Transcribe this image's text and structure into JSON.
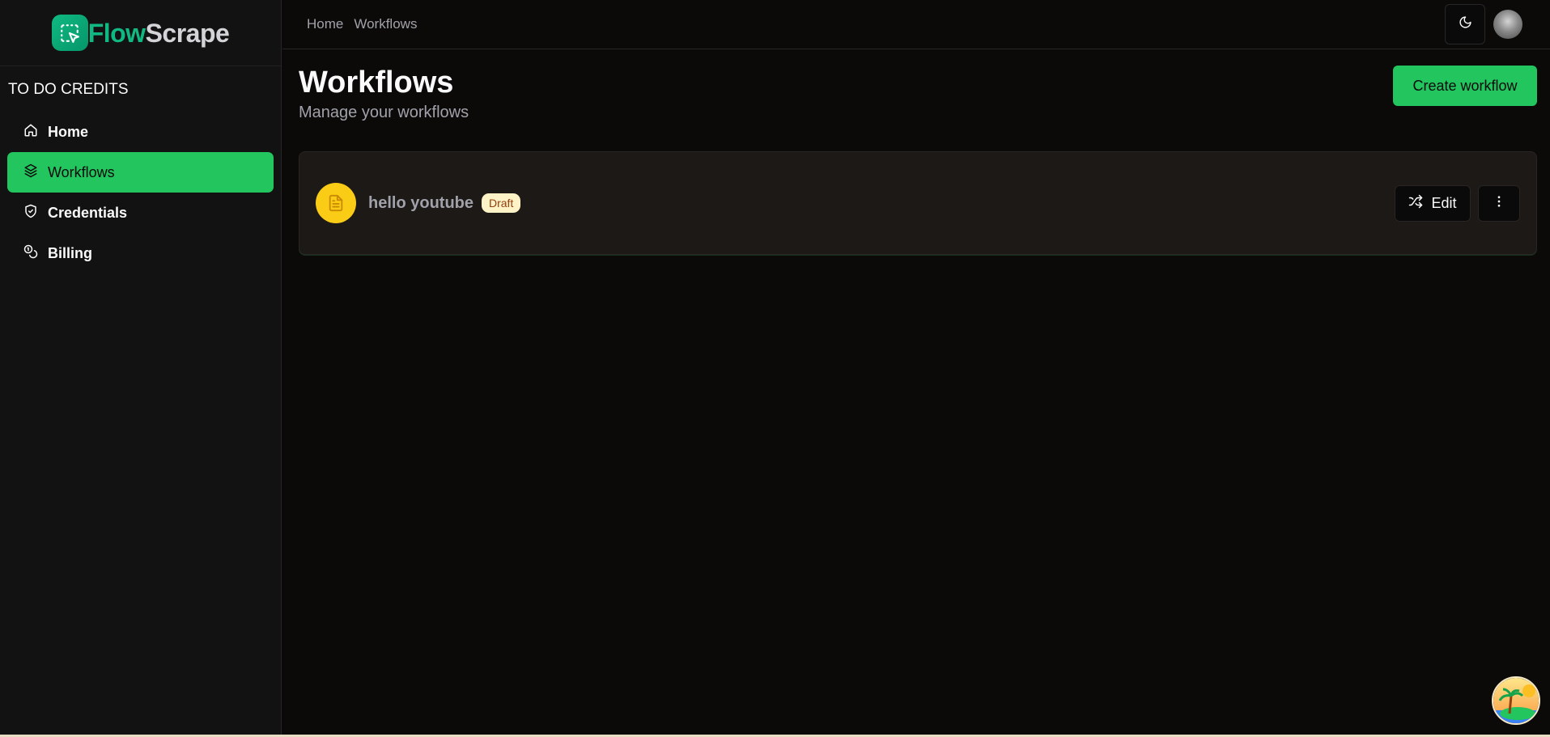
{
  "app": {
    "logo_part1": "Flow",
    "logo_part2": "Scrape"
  },
  "sidebar": {
    "credits_label": "TO DO CREDITS",
    "items": [
      {
        "label": "Home",
        "icon": "home-icon",
        "active": false
      },
      {
        "label": "Workflows",
        "icon": "layers-icon",
        "active": true
      },
      {
        "label": "Credentials",
        "icon": "shield-check-icon",
        "active": false
      },
      {
        "label": "Billing",
        "icon": "coins-icon",
        "active": false
      }
    ]
  },
  "header": {
    "breadcrumb": [
      "Home",
      "Workflows"
    ],
    "theme_icon": "moon-icon"
  },
  "main": {
    "title": "Workflows",
    "subtitle": "Manage your workflows",
    "create_button": "Create workflow",
    "workflows": [
      {
        "name": "hello youtube",
        "status": "Draft",
        "icon": "file-text-icon",
        "edit_label": "Edit"
      }
    ]
  },
  "colors": {
    "accent": "#22c55e",
    "brand": "#10b981",
    "draft_icon_bg": "#facc15",
    "badge_bg": "#fef3c7",
    "background": "#0c0a09"
  }
}
